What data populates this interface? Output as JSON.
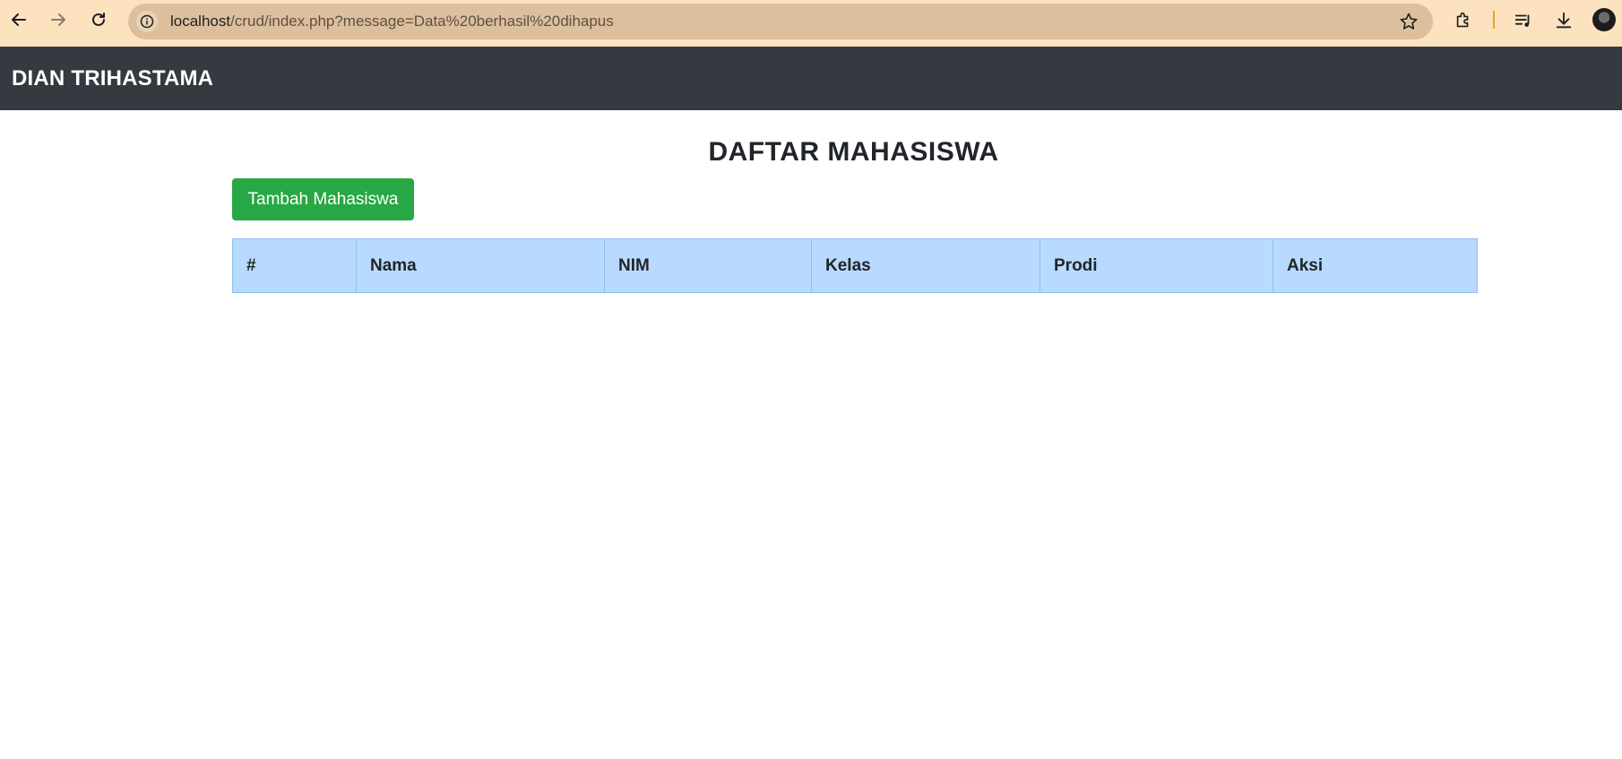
{
  "browser": {
    "url_host": "localhost",
    "url_path": "/crud/index.php?message=Data%20berhasil%20dihapus",
    "icons": {
      "back": "arrow-left-icon",
      "forward": "arrow-right-icon",
      "reload": "reload-icon",
      "site_info": "info-icon",
      "bookmark": "star-icon",
      "extensions": "puzzle-icon",
      "media": "playlist-icon",
      "downloads": "download-icon",
      "profile": "avatar"
    }
  },
  "navbar": {
    "brand": "DIAN TRIHASTAMA"
  },
  "main": {
    "title": "DAFTAR MAHASISWA",
    "add_button_label": "Tambah Mahasiswa",
    "table": {
      "columns": [
        "#",
        "Nama",
        "NIM",
        "Kelas",
        "Prodi",
        "Aksi"
      ],
      "rows": []
    }
  },
  "colors": {
    "browser_bar": "#fde2c0",
    "address_bar": "#dcbf9d",
    "navbar": "#343a40",
    "success": "#28a745",
    "table_header": "#b8daff"
  }
}
